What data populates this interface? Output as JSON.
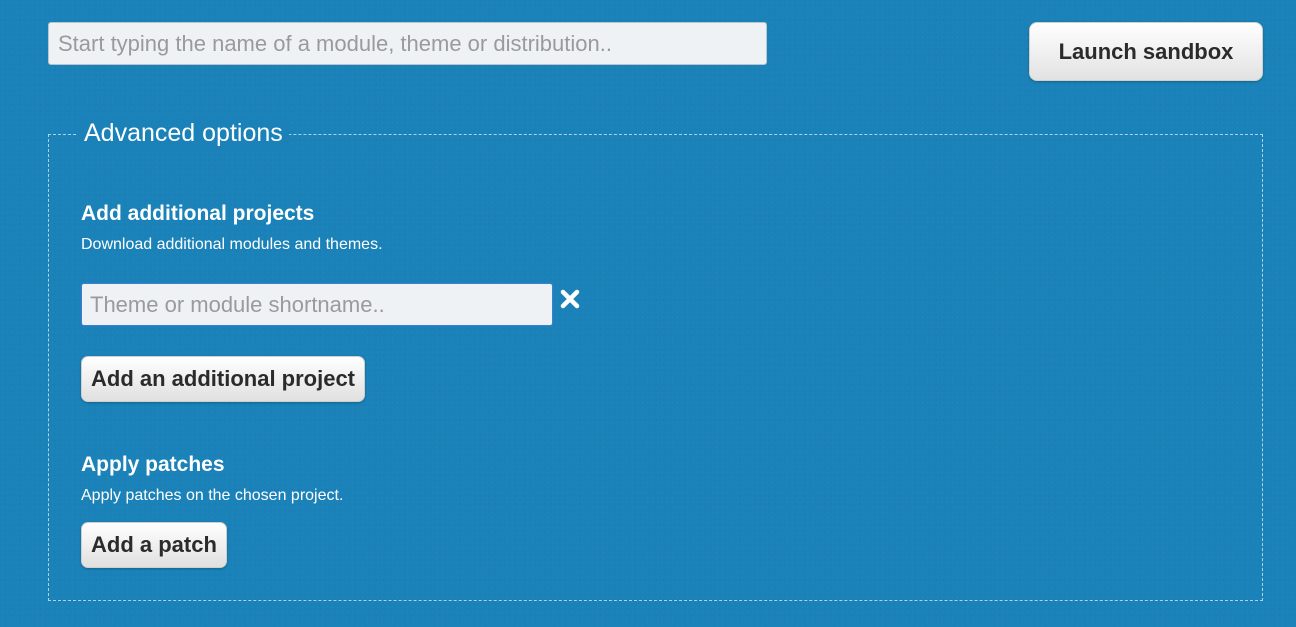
{
  "header": {
    "search_placeholder": "Start typing the name of a module, theme or distribution..",
    "launch_label": "Launch sandbox"
  },
  "advanced": {
    "legend": "Advanced options",
    "projects": {
      "title": "Add additional projects",
      "description": "Download additional modules and themes.",
      "input_placeholder": "Theme or module shortname..",
      "remove_icon": "close-x-icon",
      "add_label": "Add an additional project"
    },
    "patches": {
      "title": "Apply patches",
      "description": "Apply patches on the chosen project.",
      "add_label": "Add a patch"
    }
  },
  "colors": {
    "background": "#1a82b8",
    "text": "#ffffff",
    "button_text": "#2b2b2b",
    "input_focus_border": "#3a7fd1"
  }
}
